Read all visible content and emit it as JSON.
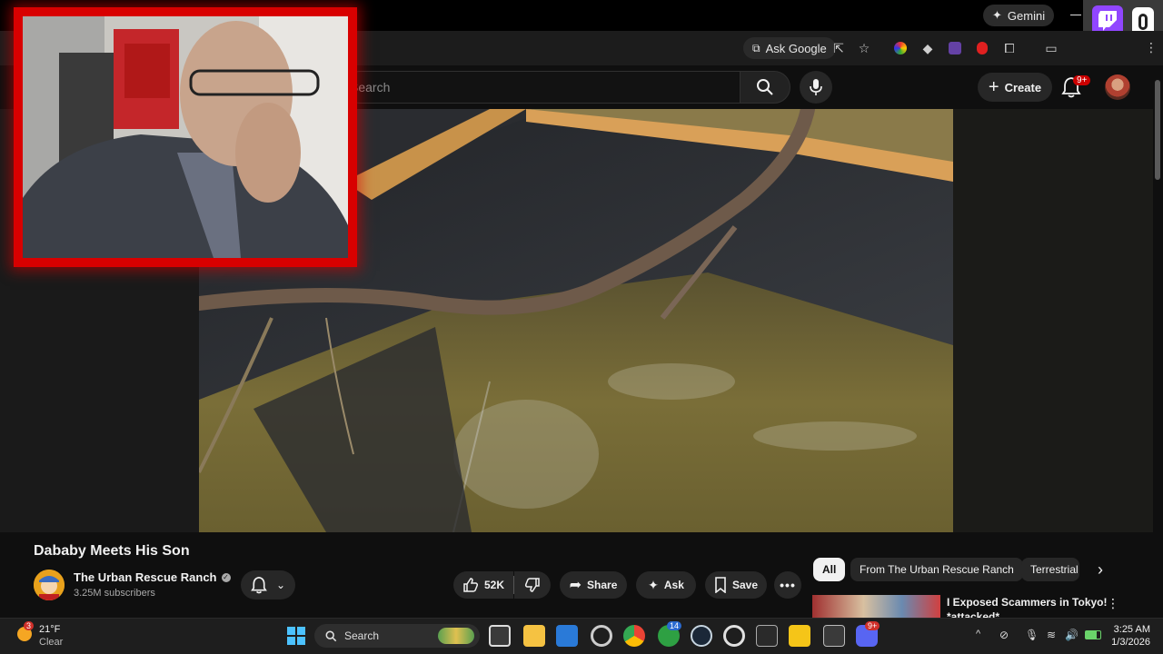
{
  "browser": {
    "gemini_label": "Gemini",
    "ask_google_label": "Ask Google"
  },
  "youtube": {
    "search_placeholder": "Search",
    "create_label": "Create",
    "notifications_badge": "9+"
  },
  "video": {
    "title": "Dababy Meets His Son"
  },
  "channel": {
    "name": "The Urban Rescue Ranch",
    "subscribers": "3.25M subscribers"
  },
  "actions": {
    "likes": "52K",
    "share_label": "Share",
    "ask_label": "Ask",
    "save_label": "Save"
  },
  "chips": [
    "All",
    "From The Urban Rescue Ranch",
    "Terrestrial"
  ],
  "recommended": {
    "title": "I Exposed Scammers in Tokyo!",
    "subtitle": "*attacked*"
  },
  "taskbar": {
    "weather_temp": "21°F",
    "weather_desc": "Clear",
    "weather_badge": "3",
    "search_label": "Search",
    "time": "3:25 AM",
    "date": "1/3/2026",
    "xbox_badge": "14",
    "discord_badge": "9+"
  },
  "colors": {
    "accent_red": "#d80000",
    "youtube_bg": "#0f0f0f",
    "twitch_purple": "#9146ff"
  }
}
